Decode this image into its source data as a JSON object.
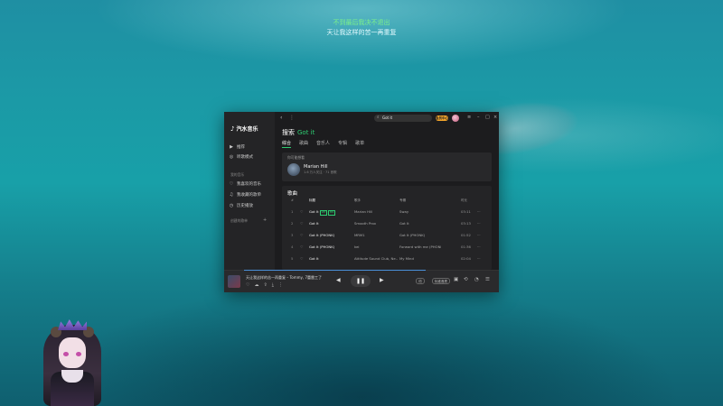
{
  "lyrics": {
    "line1": "不到最后我决不退出",
    "line2": "天让我这样的苦一再重复"
  },
  "sidebar": {
    "logo": "汽水音乐",
    "items": [
      {
        "label": "推荐",
        "icon": "play-icon"
      },
      {
        "label": "听歌模式",
        "icon": "radio-icon"
      }
    ],
    "section_mine": "我的音乐",
    "mine_items": [
      {
        "label": "我喜欢的音乐",
        "icon": "heart-icon"
      },
      {
        "label": "我收藏的歌单",
        "icon": "music-note-icon"
      },
      {
        "label": "历史播放",
        "icon": "history-icon"
      }
    ],
    "section_playlists": "创建的歌单",
    "add_label": "+"
  },
  "topbar": {
    "search_value": "Got it",
    "vip_label": "会员中心"
  },
  "search": {
    "heading": "搜索",
    "keyword": "Got it",
    "tabs": [
      "综合",
      "歌曲",
      "音乐人",
      "专辑",
      "歌单"
    ],
    "active_tab": 0
  },
  "artist": {
    "label": "你可能想看",
    "name": "Marian Hill",
    "stats": "1.6 万人关注 · 71 首歌"
  },
  "songs": {
    "title": "歌曲",
    "headers": {
      "idx": "#",
      "title": "标题",
      "artist": "歌手",
      "album": "专辑",
      "duration": "时长"
    },
    "rows": [
      {
        "idx": "1",
        "title": "Got It",
        "tags": [
          "VIP",
          "MV"
        ],
        "artist": "Marian Hill",
        "album": "Sway",
        "duration": "03:11"
      },
      {
        "idx": "2",
        "title": "Got It",
        "tags": [],
        "artist": "Smooth Prox",
        "album": "Got It",
        "duration": "03:13"
      },
      {
        "idx": "3",
        "title": "Got It (PHONK)",
        "tags": [],
        "artist": "MRM1",
        "album": "Got It (PHONK)",
        "duration": "01:52"
      },
      {
        "idx": "4",
        "title": "Got It (PHONK)",
        "tags": [],
        "artist": "kei",
        "album": "Forward with me (PHONK)",
        "duration": "01:36"
      },
      {
        "idx": "5",
        "title": "Got It",
        "tags": [],
        "artist": "Attitude Sound Club, Ne...",
        "album": "My Mind",
        "duration": "02:04"
      }
    ]
  },
  "player": {
    "now_playing": "天让我这样的苦一再重复 – Tommy, 7蕾雷工了",
    "lyric_btn": "词",
    "quality_btn": "标准音质",
    "progress": 0.88
  }
}
